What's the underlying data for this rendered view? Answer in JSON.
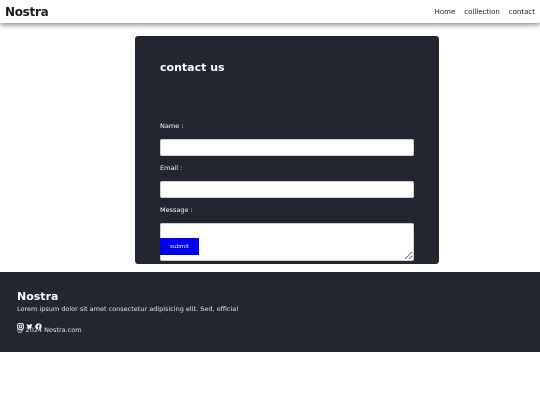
{
  "nav": {
    "brand": "Nostra",
    "links": [
      "Home",
      "colllection",
      "contact"
    ]
  },
  "form": {
    "title": "contact us",
    "name_label": "Name :",
    "email_label": "Email :",
    "message_label": "Message :",
    "submit_label": "submit"
  },
  "footer": {
    "brand": "Nostra",
    "description": "Lorem ipsum dolor sit amet consectetur adipisicing elit. Sed, officia!",
    "social_icons": [
      "instagram-icon",
      "twitter-icon",
      "facebook-icon"
    ],
    "copyright": "@ 2024 Nostra.com"
  },
  "colors": {
    "dark_panel": "#222631",
    "submit_blue": "#0000ee"
  }
}
